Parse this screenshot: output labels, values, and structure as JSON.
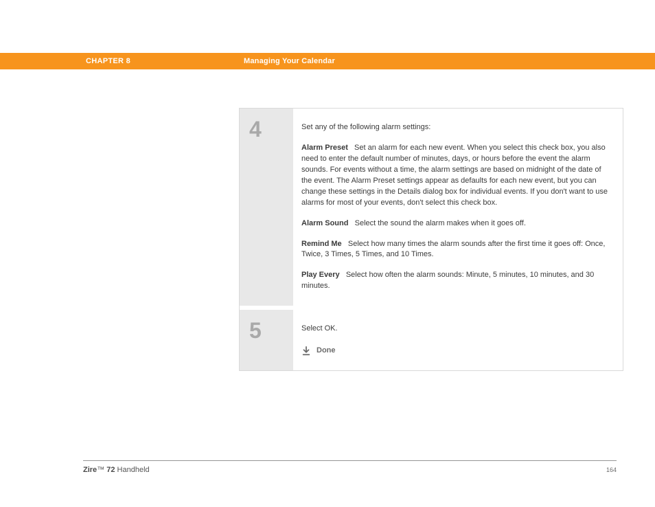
{
  "header": {
    "chapter": "CHAPTER 8",
    "title": "Managing Your Calendar"
  },
  "steps": [
    {
      "number": "4",
      "intro": "Set any of the following alarm settings:",
      "settings": [
        {
          "label": "Alarm Preset",
          "description": "Set an alarm for each new event. When you select this check box, you also need to enter the default number of minutes, days, or hours before the event the alarm sounds. For events without a time, the alarm settings are based on midnight of the date of the event. The Alarm Preset settings appear as defaults for each new event, but you can change these settings in the Details dialog box for individual events. If you don't want to use alarms for most of your events, don't select this check box."
        },
        {
          "label": "Alarm Sound",
          "description": "Select the sound the alarm makes when it goes off."
        },
        {
          "label": "Remind Me",
          "description": "Select how many times the alarm sounds after the first time it goes off: Once, Twice, 3 Times, 5 Times, and 10 Times."
        },
        {
          "label": "Play Every",
          "description": "Select how often the alarm sounds: Minute, 5 minutes, 10 minutes, and 30 minutes."
        }
      ]
    },
    {
      "number": "5",
      "intro": "Select OK.",
      "done": "Done"
    }
  ],
  "footer": {
    "brand_prefix": "Zire",
    "brand_tm": "™",
    "brand_model": " 72",
    "product_type": " Handheld",
    "page_number": "164"
  }
}
